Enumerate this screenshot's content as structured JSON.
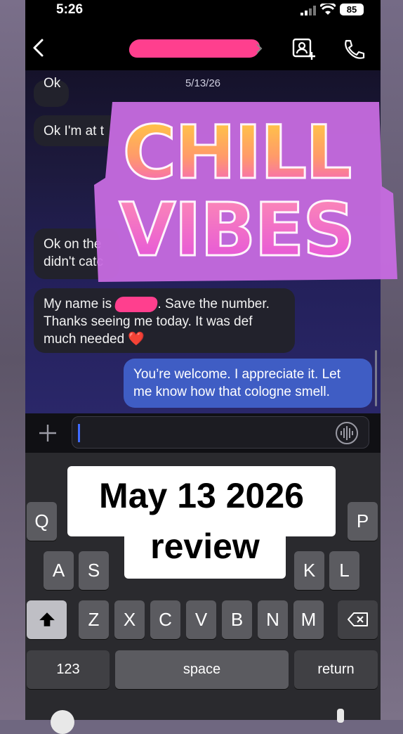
{
  "status_bar": {
    "time": "5:26",
    "battery": "85"
  },
  "header": {
    "contact_name": ""
  },
  "chat": {
    "date": "5/13/26",
    "messages": [
      {
        "direction": "in",
        "text": "Ok"
      },
      {
        "direction": "in",
        "text": "Ok I'm at t"
      },
      {
        "direction": "in",
        "line1": "Ok on the",
        "line2": "didn't catc"
      },
      {
        "direction": "in",
        "part1": "My name is ",
        "part2": ". Save the number.",
        "line2": "Thanks seeing me today. It was def",
        "line3": "much needed ❤️"
      },
      {
        "direction": "out",
        "line1": "You’re welcome. I appreciate it. Let",
        "line2": "me know how that cologne smell."
      }
    ]
  },
  "keyboard": {
    "row1": [
      "Q",
      "P"
    ],
    "row2": [
      "A",
      "S",
      "K",
      "L"
    ],
    "row3": [
      "Z",
      "X",
      "C",
      "V",
      "B",
      "N",
      "M"
    ],
    "number_key": "123",
    "space_key": "space",
    "return_key": "return"
  },
  "overlay": {
    "sticker_line1": "CHILL",
    "sticker_line2": "VIBES",
    "caption_line1": "May 13 2026",
    "caption_line2": "review"
  },
  "colors": {
    "redaction": "#ff3f8e",
    "outgoing_bubble": "#3f5dc4",
    "incoming_bubble": "#22222c"
  }
}
